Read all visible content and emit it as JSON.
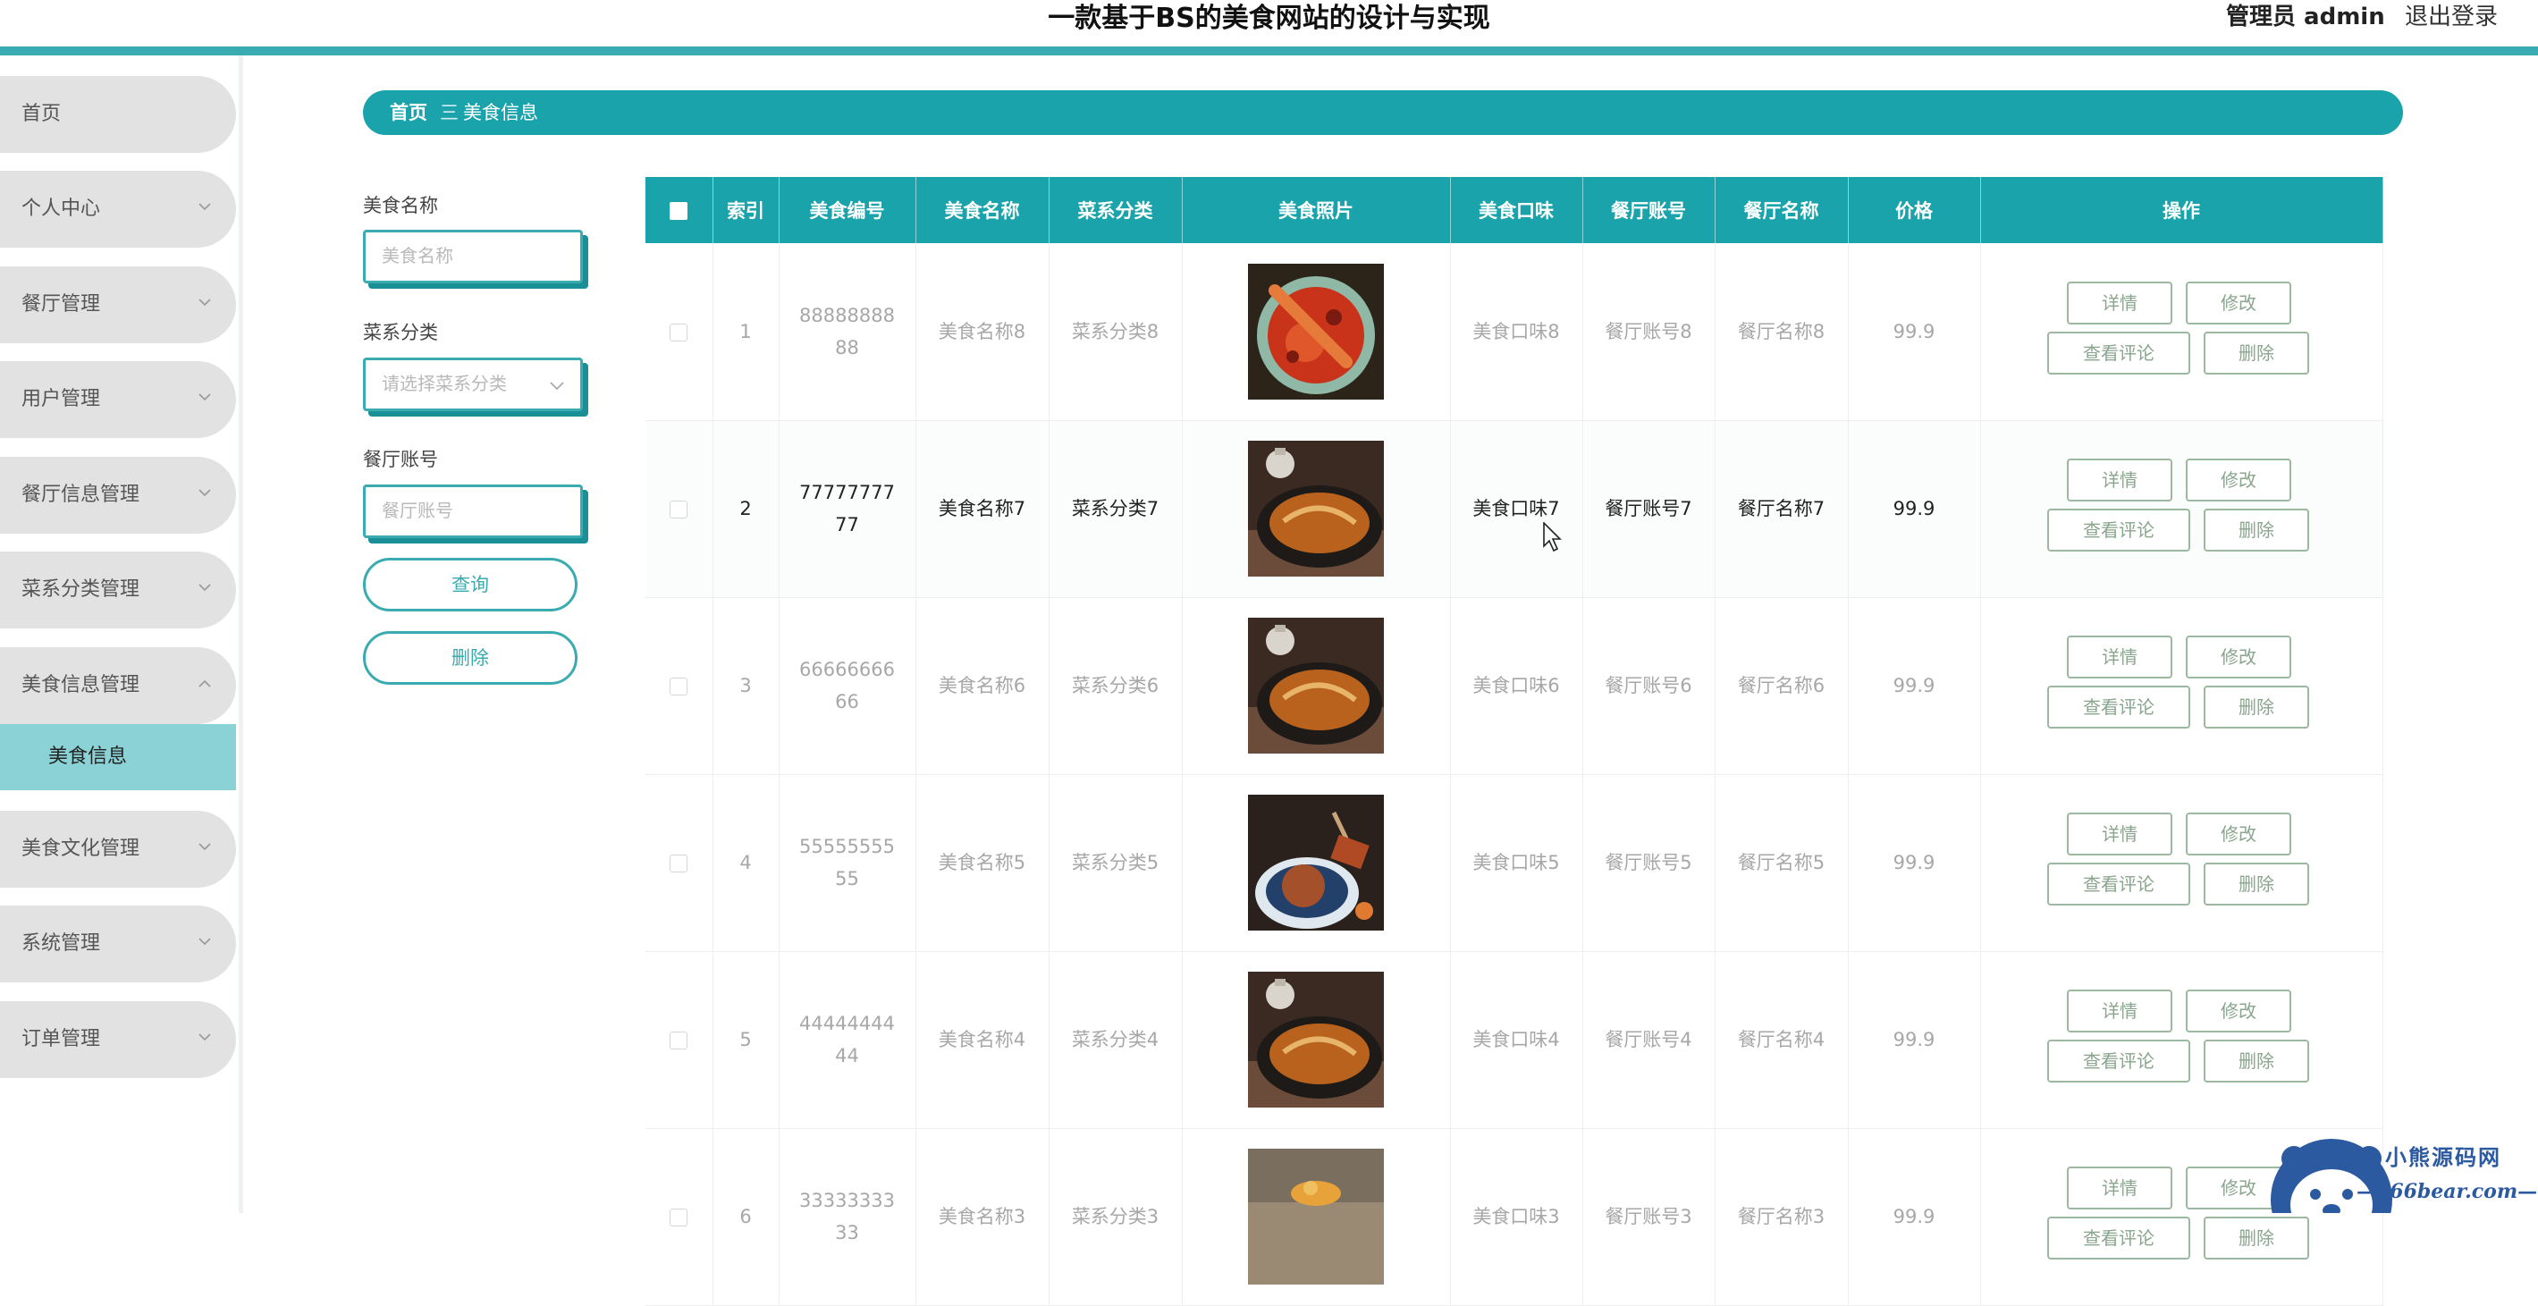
{
  "header": {
    "title": "一款基于BS的美食网站的设计与实现",
    "user_label": "管理员 admin",
    "logout_label": "退出登录"
  },
  "sidebar": {
    "items": [
      {
        "label": "首页"
      },
      {
        "label": "个人中心"
      },
      {
        "label": "餐厅管理"
      },
      {
        "label": "用户管理"
      },
      {
        "label": "餐厅信息管理"
      },
      {
        "label": "菜系分类管理"
      },
      {
        "label": "美食信息管理"
      },
      {
        "label": "美食文化管理"
      },
      {
        "label": "系统管理"
      },
      {
        "label": "订单管理"
      }
    ],
    "active_sub": "美食信息"
  },
  "breadcrumb": {
    "home": "首页",
    "separator": "三",
    "current": "美食信息"
  },
  "filters": {
    "name_label": "美食名称",
    "name_placeholder": "美食名称",
    "category_label": "菜系分类",
    "category_placeholder": "请选择菜系分类",
    "account_label": "餐厅账号",
    "account_placeholder": "餐厅账号",
    "search_button": "查询",
    "delete_button": "删除"
  },
  "table": {
    "columns": [
      "索引",
      "美食编号",
      "美食名称",
      "菜系分类",
      "美食照片",
      "美食口味",
      "餐厅账号",
      "餐厅名称",
      "价格",
      "操作"
    ],
    "actions": {
      "detail": "详情",
      "edit": "修改",
      "comments": "查看评论",
      "delete": "删除"
    },
    "rows": [
      {
        "index": "1",
        "code": "8888888888",
        "name": "美食名称8",
        "category": "菜系分类8",
        "taste": "美食口味8",
        "account": "餐厅账号8",
        "restaurant": "餐厅名称8",
        "price": "99.9"
      },
      {
        "index": "2",
        "code": "7777777777",
        "name": "美食名称7",
        "category": "菜系分类7",
        "taste": "美食口味7",
        "account": "餐厅账号7",
        "restaurant": "餐厅名称7",
        "price": "99.9"
      },
      {
        "index": "3",
        "code": "6666666666",
        "name": "美食名称6",
        "category": "菜系分类6",
        "taste": "美食口味6",
        "account": "餐厅账号6",
        "restaurant": "餐厅名称6",
        "price": "99.9"
      },
      {
        "index": "4",
        "code": "5555555555",
        "name": "美食名称5",
        "category": "菜系分类5",
        "taste": "美食口味5",
        "account": "餐厅账号5",
        "restaurant": "餐厅名称5",
        "price": "99.9"
      },
      {
        "index": "5",
        "code": "4444444444",
        "name": "美食名称4",
        "category": "菜系分类4",
        "taste": "美食口味4",
        "account": "餐厅账号4",
        "restaurant": "餐厅名称4",
        "price": "99.9"
      },
      {
        "index": "6",
        "code": "3333333333",
        "name": "美食名称3",
        "category": "菜系分类3",
        "taste": "美食口味3",
        "account": "餐厅账号3",
        "restaurant": "餐厅名称3",
        "price": "99.9"
      }
    ]
  },
  "watermark": {
    "name": "小熊源码网",
    "url": "—666bear.com—"
  },
  "colors": {
    "accent": "#1aa3ab",
    "accent_light": "#8ad2d5",
    "button_border": "#9cb89f"
  }
}
